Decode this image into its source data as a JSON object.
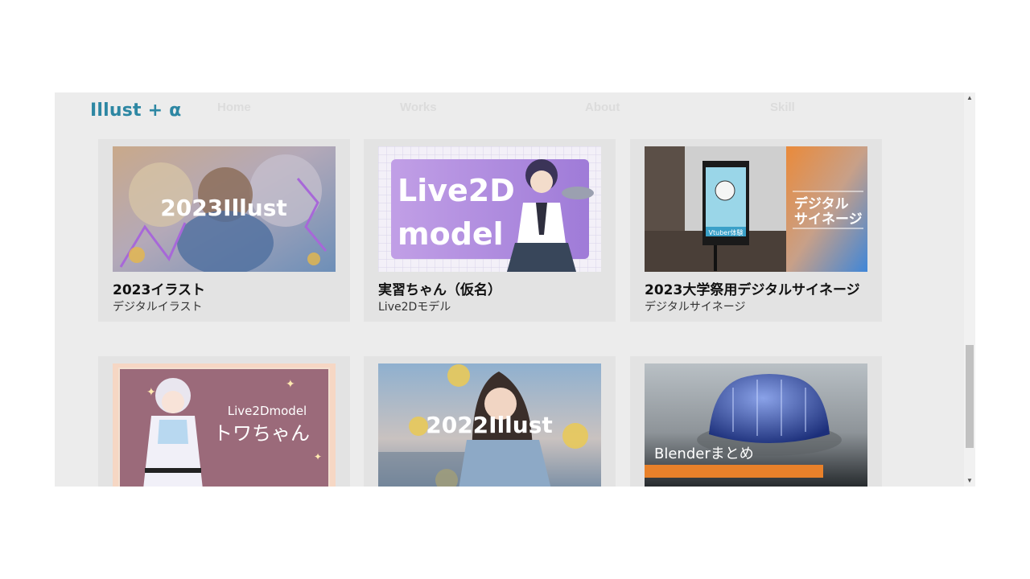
{
  "site": {
    "logo": "Illust + α"
  },
  "nav": [
    {
      "label": "Home"
    },
    {
      "label": "Works"
    },
    {
      "label": "About"
    },
    {
      "label": "Skill"
    }
  ],
  "works": [
    {
      "title": "2023イラスト",
      "category": "デジタルイラスト",
      "thumb_text": "2023Illust"
    },
    {
      "title": "実習ちゃん（仮名）",
      "category": "Live2Dモデル",
      "thumb_text": [
        "Live2D",
        "model"
      ]
    },
    {
      "title": "2023大学祭用デジタルサイネージ",
      "category": "デジタルサイネージ",
      "thumb_text": [
        "デジタル",
        "サイネージ"
      ],
      "sign_label": "Vtuber体験"
    },
    {
      "title": "",
      "category": "",
      "thumb_text": [
        "Live2Dmodel",
        "トワちゃん"
      ]
    },
    {
      "title": "",
      "category": "",
      "thumb_text": "2022Illust"
    },
    {
      "title": "",
      "category": "",
      "thumb_text": "Blenderまとめ"
    }
  ],
  "colors": {
    "logo": "#2d87a3",
    "nav": "#dcdcdc",
    "page_bg": "#ececec",
    "card_bg": "#e3e3e3",
    "blender_bar": "#e9812a"
  }
}
